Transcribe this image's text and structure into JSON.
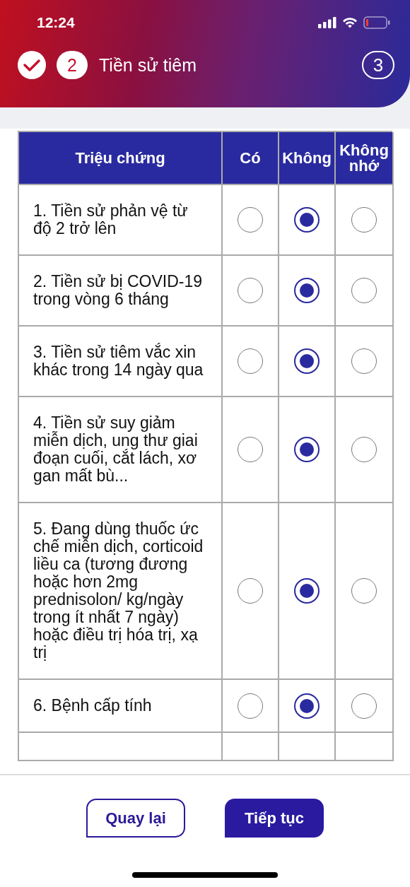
{
  "status_bar": {
    "time": "12:24"
  },
  "steps": [
    {
      "kind": "done"
    },
    {
      "kind": "current",
      "number": "2",
      "label": "Tiền sử tiêm"
    },
    {
      "kind": "upcoming",
      "number": "3"
    }
  ],
  "table": {
    "columns": [
      "Triệu chứng",
      "Có",
      "Không",
      "Không nhớ"
    ],
    "rows": [
      {
        "symptom": "1. Tiền sử phản vệ từ độ 2 trở lên",
        "options": [
          {
            "selected": false
          },
          {
            "selected": true
          },
          {
            "selected": false
          }
        ]
      },
      {
        "symptom": "2. Tiền sử bị COVID-19 trong vòng 6 tháng",
        "options": [
          {
            "selected": false
          },
          {
            "selected": true
          },
          {
            "selected": false
          }
        ]
      },
      {
        "symptom": "3. Tiền sử tiêm vắc xin khác trong 14 ngày qua",
        "options": [
          {
            "selected": false
          },
          {
            "selected": true
          },
          {
            "selected": false
          }
        ]
      },
      {
        "symptom": "4. Tiền sử suy giảm miễn dịch, ung thư giai đoạn cuối, cắt lách, xơ gan mất bù...",
        "options": [
          {
            "selected": false
          },
          {
            "selected": true
          },
          {
            "selected": false
          }
        ]
      },
      {
        "symptom": "5. Đang dùng thuốc ức chế miễn dịch, corticoid liều ca (tương đương hoặc hơn 2mg prednisolon/ kg/ngày trong ít nhất 7 ngày) hoặc điều trị hóa trị, xạ trị",
        "options": [
          {
            "selected": false
          },
          {
            "selected": true
          },
          {
            "selected": false
          }
        ]
      },
      {
        "symptom": "6. Bệnh cấp tính",
        "options": [
          {
            "selected": false
          },
          {
            "selected": true
          },
          {
            "selected": false
          }
        ]
      }
    ]
  },
  "buttons": [
    {
      "label": "Quay lại",
      "kind": "secondary"
    },
    {
      "label": "Tiếp tục",
      "kind": "primary"
    }
  ]
}
